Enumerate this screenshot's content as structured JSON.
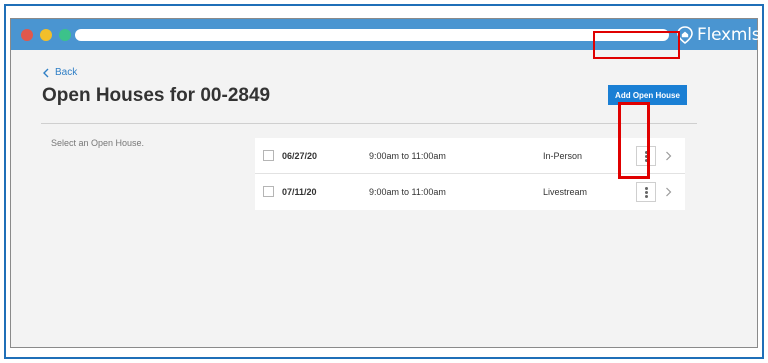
{
  "window": {
    "brand": "Flexmls",
    "brand_icon": "house-pin-icon",
    "traffic_lights": [
      "#e0584c",
      "#f2bf2a",
      "#3cc28a"
    ],
    "accent": "#4a95d1"
  },
  "page": {
    "back_label": "Back",
    "title": "Open Houses for 00-2849",
    "add_button_label": "Add Open House",
    "prompt": "Select an Open House."
  },
  "open_houses": [
    {
      "date": "06/27/20",
      "time": "9:00am to 11:00am",
      "type": "In-Person"
    },
    {
      "date": "07/11/20",
      "time": "9:00am to 11:00am",
      "type": "Livestream"
    }
  ],
  "colors": {
    "primary_button": "#1a7fd4",
    "link": "#2f7fc6",
    "highlight": "#e00000"
  }
}
